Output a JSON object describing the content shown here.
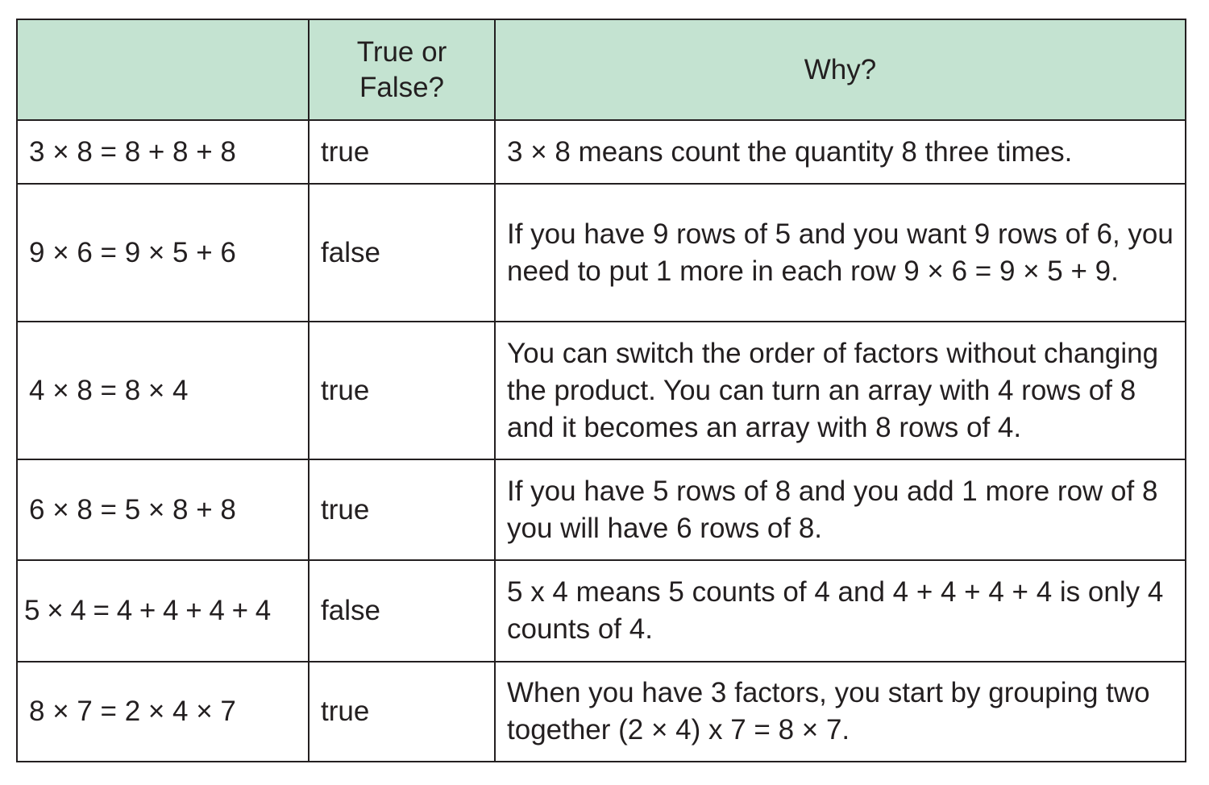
{
  "header": {
    "col1": "",
    "col2_line1": "True or",
    "col2_line2": "False?",
    "col3": "Why?"
  },
  "rows": [
    {
      "statement": "3 × 8 = 8 + 8 + 8",
      "value": "true",
      "why": "3 × 8 means count the quantity 8 three times."
    },
    {
      "statement": "9 × 6 = 9 × 5 + 6",
      "value": "false",
      "why": "If you have 9 rows of 5 and you want 9 rows of 6, you need to put 1 more in each row 9 × 6 = 9 × 5 + 9."
    },
    {
      "statement": "4 × 8 = 8 × 4",
      "value": "true",
      "why": "You can switch the order of factors without changing the product. You can turn an array with 4 rows of 8 and it becomes an array with 8 rows of 4."
    },
    {
      "statement": "6 × 8 = 5 × 8 + 8",
      "value": "true",
      "why": "If you have 5 rows of 8 and you add 1 more row of 8 you will have 6 rows of 8."
    },
    {
      "statement": "5 × 4 = 4 + 4 + 4 + 4",
      "value": "false",
      "why": "5 x 4 means 5 counts of 4 and 4 + 4 + 4 + 4 is only 4 counts of 4."
    },
    {
      "statement": "8 × 7 = 2 × 4 × 7",
      "value": "true",
      "why": "When you have 3 factors, you start by grouping two together (2 × 4) x 7 = 8 × 7."
    }
  ]
}
